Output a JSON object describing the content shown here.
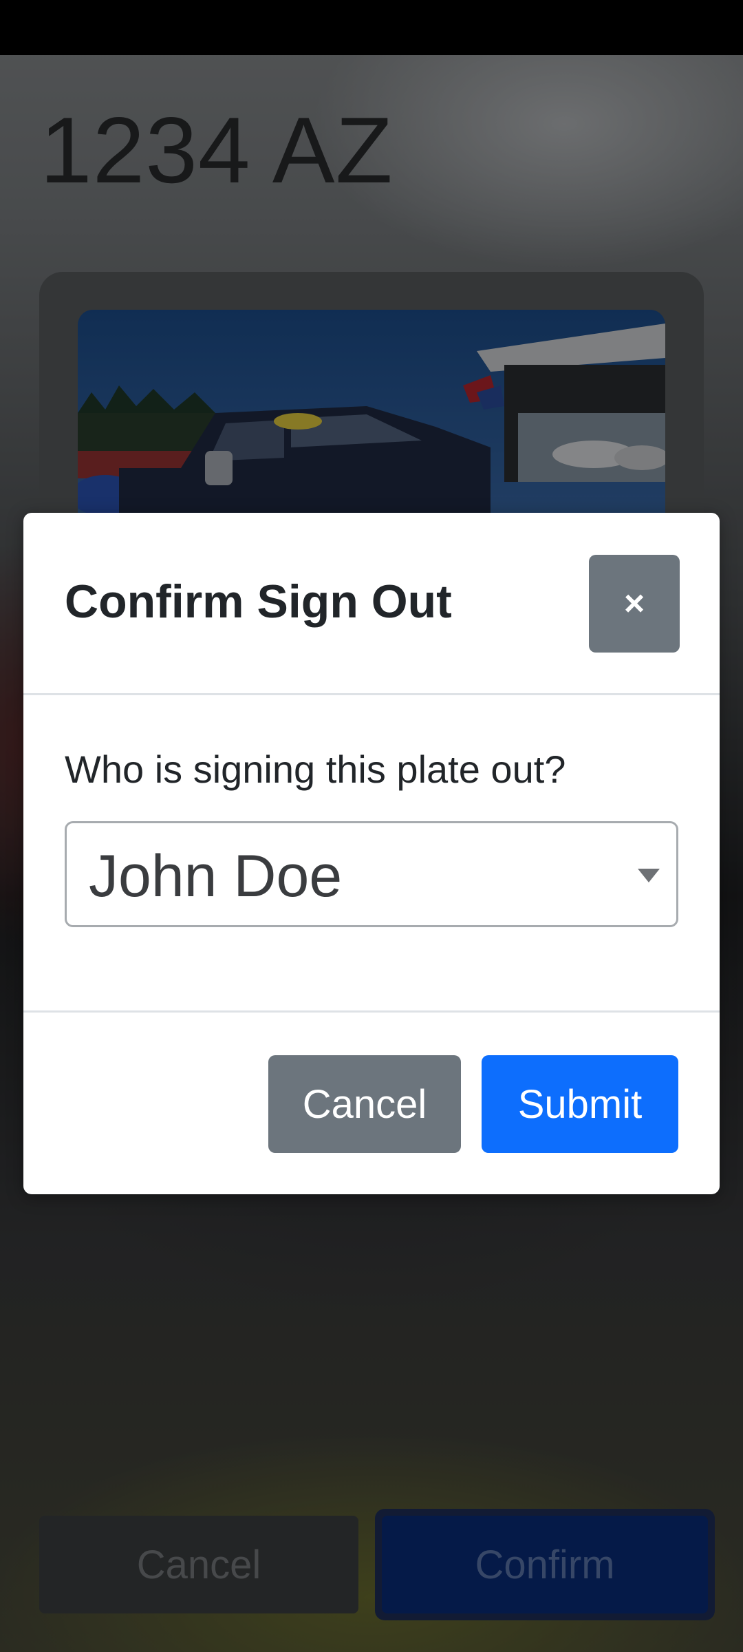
{
  "app": {
    "plate_title": "1234 AZ",
    "vehicle_photo_icon": "pickup-truck-photo",
    "bottom_cancel_label": "Cancel",
    "bottom_confirm_label": "Confirm"
  },
  "modal": {
    "title": "Confirm Sign Out",
    "close_label": "×",
    "question": "Who is signing this plate out?",
    "signer_select": {
      "value": "John Doe"
    },
    "cancel_label": "Cancel",
    "submit_label": "Submit"
  },
  "colors": {
    "primary": "#0d6efd",
    "secondary": "#6c757d"
  }
}
